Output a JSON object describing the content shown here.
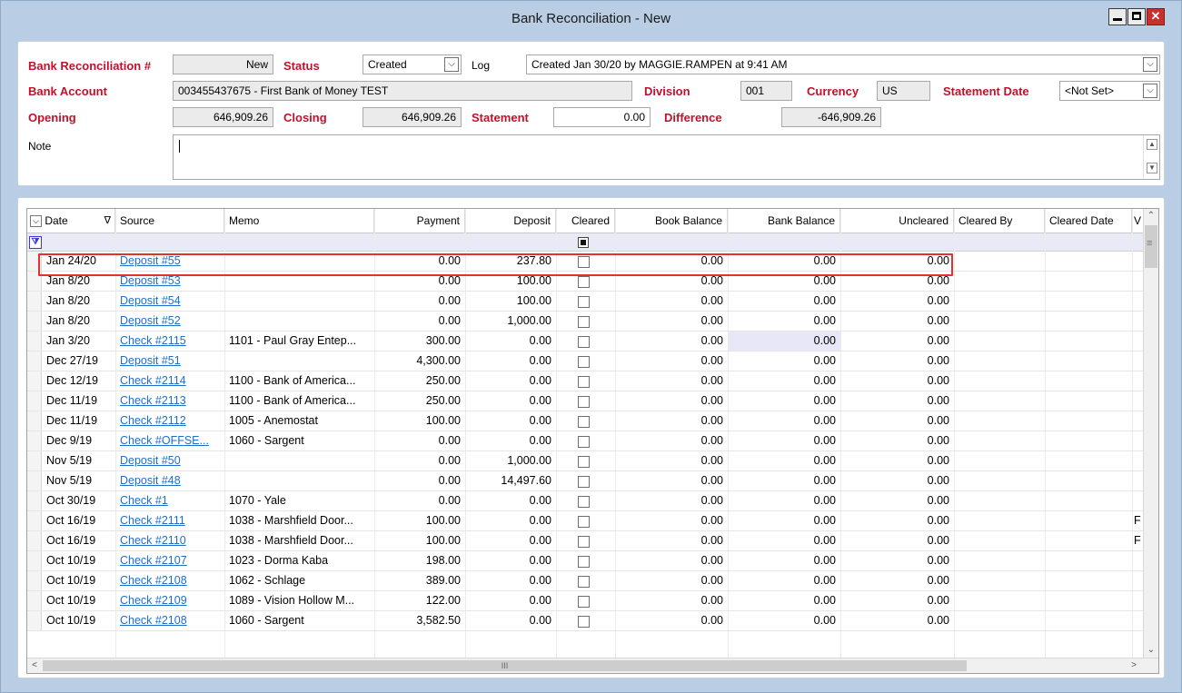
{
  "window": {
    "title": "Bank Reconciliation - New"
  },
  "header": {
    "recon_label": "Bank Reconciliation #",
    "recon_value": "New",
    "status_label": "Status",
    "status_value": "Created",
    "log_label": "Log",
    "log_value": "Created Jan 30/20 by MAGGIE.RAMPEN at 9:41 AM",
    "bank_account_label": "Bank Account",
    "bank_account_value": "003455437675 - First Bank of Money TEST",
    "division_label": "Division",
    "division_value": "001",
    "currency_label": "Currency",
    "currency_value": "US",
    "statement_date_label": "Statement Date",
    "statement_date_value": "<Not Set>",
    "opening_label": "Opening",
    "opening_value": "646,909.26",
    "closing_label": "Closing",
    "closing_value": "646,909.26",
    "statement_label": "Statement",
    "statement_value": "0.00",
    "difference_label": "Difference",
    "difference_value": "-646,909.26",
    "note_label": "Note",
    "note_value": ""
  },
  "grid": {
    "columns": {
      "date": "Date",
      "source": "Source",
      "memo": "Memo",
      "payment": "Payment",
      "deposit": "Deposit",
      "cleared": "Cleared",
      "book_balance": "Book Balance",
      "bank_balance": "Bank Balance",
      "uncleared": "Uncleared",
      "cleared_by": "Cleared By",
      "cleared_date": "Cleared Date",
      "extra": "V"
    },
    "rows": [
      {
        "date": "Jan 24/20",
        "source": "Deposit #55",
        "memo": "",
        "payment": "0.00",
        "deposit": "237.80",
        "book": "0.00",
        "bank": "0.00",
        "uncleared": "0.00",
        "extra": ""
      },
      {
        "date": "Jan 8/20",
        "source": "Deposit #53",
        "memo": "",
        "payment": "0.00",
        "deposit": "100.00",
        "book": "0.00",
        "bank": "0.00",
        "uncleared": "0.00",
        "extra": ""
      },
      {
        "date": "Jan 8/20",
        "source": "Deposit #54",
        "memo": "",
        "payment": "0.00",
        "deposit": "100.00",
        "book": "0.00",
        "bank": "0.00",
        "uncleared": "0.00",
        "extra": ""
      },
      {
        "date": "Jan 8/20",
        "source": "Deposit #52",
        "memo": "",
        "payment": "0.00",
        "deposit": "1,000.00",
        "book": "0.00",
        "bank": "0.00",
        "uncleared": "0.00",
        "extra": ""
      },
      {
        "date": "Jan 3/20",
        "source": "Check #2115",
        "memo": "1101 - Paul Gray Entep...",
        "payment": "300.00",
        "deposit": "0.00",
        "book": "0.00",
        "bank": "0.00",
        "uncleared": "0.00",
        "extra": ""
      },
      {
        "date": "Dec 27/19",
        "source": "Deposit #51",
        "memo": "",
        "payment": "4,300.00",
        "deposit": "0.00",
        "book": "0.00",
        "bank": "0.00",
        "uncleared": "0.00",
        "extra": ""
      },
      {
        "date": "Dec 12/19",
        "source": "Check #2114",
        "memo": "1100 - Bank of America...",
        "payment": "250.00",
        "deposit": "0.00",
        "book": "0.00",
        "bank": "0.00",
        "uncleared": "0.00",
        "extra": ""
      },
      {
        "date": "Dec 11/19",
        "source": "Check #2113",
        "memo": "1100 - Bank of America...",
        "payment": "250.00",
        "deposit": "0.00",
        "book": "0.00",
        "bank": "0.00",
        "uncleared": "0.00",
        "extra": ""
      },
      {
        "date": "Dec 11/19",
        "source": "Check #2112",
        "memo": "1005 - Anemostat",
        "payment": "100.00",
        "deposit": "0.00",
        "book": "0.00",
        "bank": "0.00",
        "uncleared": "0.00",
        "extra": ""
      },
      {
        "date": "Dec 9/19",
        "source": "Check #OFFSE...",
        "memo": "1060 - Sargent",
        "payment": "0.00",
        "deposit": "0.00",
        "book": "0.00",
        "bank": "0.00",
        "uncleared": "0.00",
        "extra": ""
      },
      {
        "date": "Nov 5/19",
        "source": "Deposit #50",
        "memo": "",
        "payment": "0.00",
        "deposit": "1,000.00",
        "book": "0.00",
        "bank": "0.00",
        "uncleared": "0.00",
        "extra": ""
      },
      {
        "date": "Nov 5/19",
        "source": "Deposit #48",
        "memo": "",
        "payment": "0.00",
        "deposit": "14,497.60",
        "book": "0.00",
        "bank": "0.00",
        "uncleared": "0.00",
        "extra": ""
      },
      {
        "date": "Oct 30/19",
        "source": "Check #1",
        "memo": "1070 - Yale",
        "payment": "0.00",
        "deposit": "0.00",
        "book": "0.00",
        "bank": "0.00",
        "uncleared": "0.00",
        "extra": ""
      },
      {
        "date": "Oct 16/19",
        "source": "Check #2111",
        "memo": "1038 - Marshfield Door...",
        "payment": "100.00",
        "deposit": "0.00",
        "book": "0.00",
        "bank": "0.00",
        "uncleared": "0.00",
        "extra": "F"
      },
      {
        "date": "Oct 16/19",
        "source": "Check #2110",
        "memo": "1038 - Marshfield Door...",
        "payment": "100.00",
        "deposit": "0.00",
        "book": "0.00",
        "bank": "0.00",
        "uncleared": "0.00",
        "extra": "F"
      },
      {
        "date": "Oct 10/19",
        "source": "Check #2107",
        "memo": "1023 - Dorma Kaba",
        "payment": "198.00",
        "deposit": "0.00",
        "book": "0.00",
        "bank": "0.00",
        "uncleared": "0.00",
        "extra": ""
      },
      {
        "date": "Oct 10/19",
        "source": "Check #2108",
        "memo": "1062 - Schlage",
        "payment": "389.00",
        "deposit": "0.00",
        "book": "0.00",
        "bank": "0.00",
        "uncleared": "0.00",
        "extra": ""
      },
      {
        "date": "Oct 10/19",
        "source": "Check #2109",
        "memo": "1089 - Vision Hollow M...",
        "payment": "122.00",
        "deposit": "0.00",
        "book": "0.00",
        "bank": "0.00",
        "uncleared": "0.00",
        "extra": ""
      },
      {
        "date": "Oct 10/19",
        "source": "Check #2108",
        "memo": "1060 - Sargent",
        "payment": "3,582.50",
        "deposit": "0.00",
        "book": "0.00",
        "bank": "0.00",
        "uncleared": "0.00",
        "extra": ""
      }
    ]
  },
  "colors": {
    "label_red": "#c0122b",
    "link_blue": "#1e6fc9",
    "highlight_red": "#e0322f"
  },
  "icons": {
    "minimize": "minimize-icon",
    "maximize": "maximize-icon",
    "close": "close-icon",
    "dropdown": "chevron-down-icon",
    "filter": "filter-icon",
    "sort": "sort-desc-icon"
  }
}
